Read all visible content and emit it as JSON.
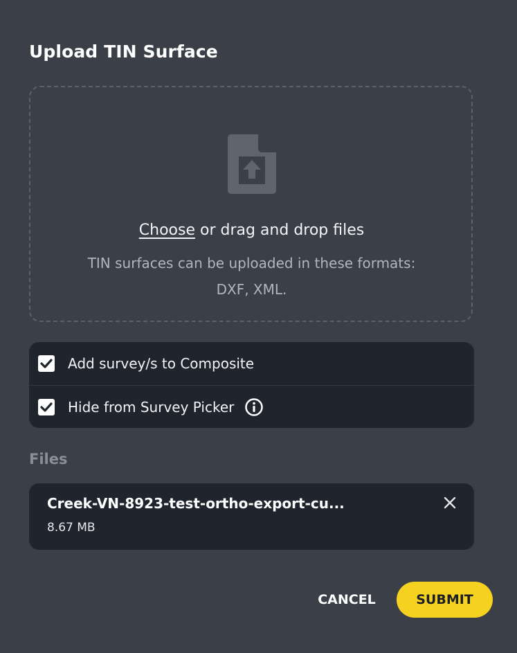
{
  "dialog": {
    "title": "Upload TIN Surface"
  },
  "dropzone": {
    "icon": "file-upload-icon",
    "choose_label": "Choose",
    "drag_text": " or drag and drop files",
    "hint_line1": "TIN surfaces can be uploaded in these formats:",
    "hint_line2": "DXF, XML."
  },
  "options": [
    {
      "label": "Add survey/s to Composite",
      "checked": true
    },
    {
      "label": "Hide from Survey Picker",
      "checked": true,
      "icon": "info-icon"
    }
  ],
  "files": {
    "heading": "Files",
    "items": [
      {
        "name": "Creek-VN-8923-test-ortho-export-cu...",
        "size": "8.67 MB",
        "remove_icon": "close-icon"
      }
    ]
  },
  "actions": {
    "cancel_label": "CANCEL",
    "submit_label": "SUBMIT"
  },
  "colors": {
    "background": "#3a3f48",
    "panel": "#20252d",
    "accent": "#f5d21f"
  }
}
